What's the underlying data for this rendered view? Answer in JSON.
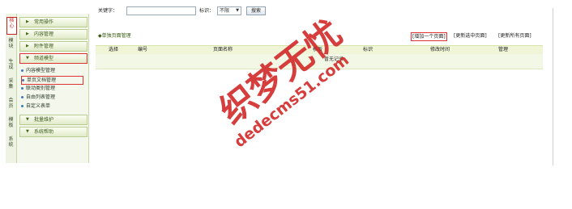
{
  "left_tabs": [
    "核心",
    "模块",
    "生成",
    "采集",
    "会员",
    "模板",
    "系统"
  ],
  "menu": {
    "groups": [
      {
        "label": "常用操作"
      },
      {
        "label": "内容管理"
      },
      {
        "label": "附件管理"
      },
      {
        "label": "频道模型"
      }
    ],
    "items": [
      {
        "label": "内容模型管理"
      },
      {
        "label": "单页文档管理"
      },
      {
        "label": "联动类别管理"
      },
      {
        "label": "自由列表管理"
      },
      {
        "label": "自定义表单"
      }
    ],
    "groups_after": [
      {
        "label": "批量维护"
      },
      {
        "label": "系统帮助"
      }
    ]
  },
  "search": {
    "keyword_label": "关键字：",
    "keyword_value": "",
    "tag_label": "标识：",
    "tag_selected": "不限",
    "search_button": "搜索"
  },
  "list": {
    "title": "◆单独页面管理",
    "links": [
      "[增加一个页面]",
      "[更新选中页面]",
      "[更新所有页面]"
    ],
    "columns": [
      "选择",
      "编号",
      "页面名称",
      "模板",
      "标识",
      "修改时间",
      "管理"
    ],
    "row_text": "暂无记录"
  },
  "watermark": {
    "cn": "织梦无忧",
    "url": "dedecms51.com"
  }
}
